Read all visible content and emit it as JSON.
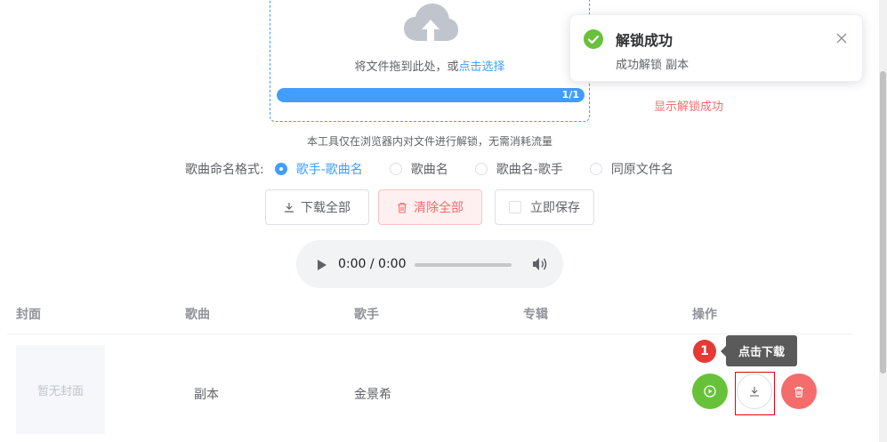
{
  "upload": {
    "text_prefix": "将文件拖到此处，或",
    "text_link": "点击选择",
    "progress_fraction": 1.0,
    "progress_label": "1/1"
  },
  "annotation": {
    "unlock_text": "显示解锁成功",
    "tooltip": "点击下载",
    "step_number": "1"
  },
  "tip": "本工具仅在浏览器内对文件进行解锁，无需消耗流量",
  "format": {
    "label": "歌曲命名格式:",
    "options": [
      {
        "label": "歌手-歌曲名",
        "checked": true
      },
      {
        "label": "歌曲名",
        "checked": false
      },
      {
        "label": "歌曲名-歌手",
        "checked": false
      },
      {
        "label": "同原文件名",
        "checked": false
      }
    ]
  },
  "actions": {
    "download_all": "下载全部",
    "clear_all": "清除全部",
    "save_now": "立即保存"
  },
  "audio": {
    "time": "0:00 / 0:00"
  },
  "table": {
    "headers": [
      "封面",
      "歌曲",
      "歌手",
      "专辑",
      "操作"
    ],
    "rows": [
      {
        "cover": "暂无封面",
        "song": "副本",
        "artist": "金景希",
        "album": ""
      }
    ]
  },
  "notification": {
    "title": "解锁成功",
    "message": "成功解锁 副本"
  },
  "colors": {
    "primary": "#409eff",
    "success": "#67c23a",
    "danger": "#f56c6c",
    "annotation_red": "#e53935"
  }
}
